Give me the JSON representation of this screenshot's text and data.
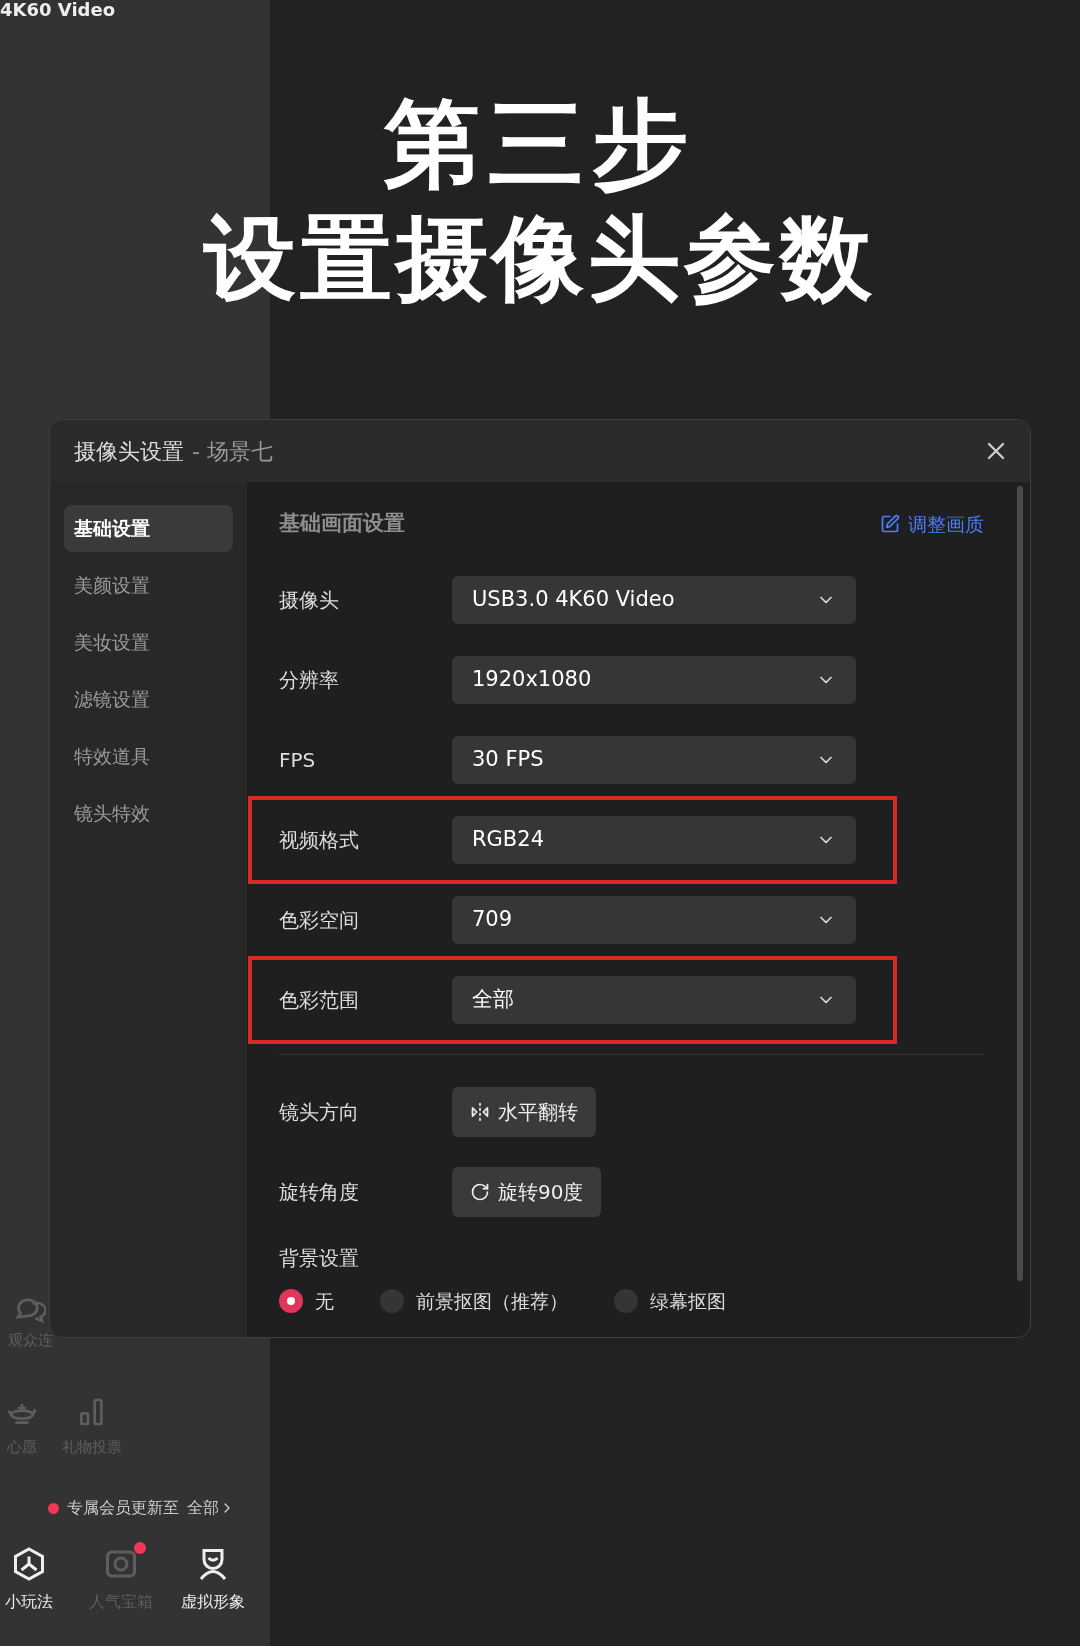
{
  "background_app": {
    "video_label": "4K60 Video",
    "features": [
      {
        "kind": "chat",
        "label": "观众连",
        "disabled": true
      }
    ],
    "tools": [
      {
        "kind": "lamp",
        "label": "心愿",
        "disabled": true
      },
      {
        "kind": "bars",
        "label": "礼物投票",
        "disabled": true
      }
    ],
    "notice": {
      "text": "专属会员更新至",
      "link": "全部"
    },
    "bottom_tabs": [
      {
        "kind": "hexagon",
        "label": "小玩法",
        "disabled": false,
        "badge": false
      },
      {
        "kind": "camera",
        "label": "人气宝箱",
        "disabled": true,
        "badge": true
      },
      {
        "kind": "avatar",
        "label": "虚拟形象",
        "disabled": false,
        "badge": false
      }
    ]
  },
  "headline": {
    "line_1": "第三步",
    "line_2": "设置摄像头参数"
  },
  "dialog": {
    "title": "摄像头设置",
    "subtitle": "- 场景七",
    "nav": [
      {
        "label": "基础设置",
        "selected": true
      },
      {
        "label": "美颜设置",
        "selected": false
      },
      {
        "label": "美妆设置",
        "selected": false
      },
      {
        "label": "滤镜设置",
        "selected": false
      },
      {
        "label": "特效道具",
        "selected": false
      },
      {
        "label": "镜头特效",
        "selected": false
      }
    ],
    "section_title": "基础画面设置",
    "adjust_link": "调整画质",
    "fields": [
      {
        "label": "摄像头",
        "value": "USB3.0 4K60 Video",
        "highlighted": false
      },
      {
        "label": "分辨率",
        "value": "1920x1080",
        "highlighted": false
      },
      {
        "label": "FPS",
        "value": "30 FPS",
        "highlighted": false
      },
      {
        "label": "视频格式",
        "value": "RGB24",
        "highlighted": true
      },
      {
        "label": "色彩空间",
        "value": "709",
        "highlighted": false
      },
      {
        "label": "色彩范围",
        "value": "全部",
        "highlighted": true
      }
    ],
    "actions": [
      {
        "kind": "flip",
        "label": "镜头方向",
        "button": "水平翻转"
      },
      {
        "kind": "rotate",
        "label": "旋转角度",
        "button": "旋转90度"
      }
    ],
    "background": {
      "label": "背景设置",
      "options": [
        {
          "label": "无",
          "selected": true
        },
        {
          "label": "前景抠图（推荐）",
          "selected": false
        },
        {
          "label": "绿幕抠图",
          "selected": false
        }
      ]
    }
  }
}
